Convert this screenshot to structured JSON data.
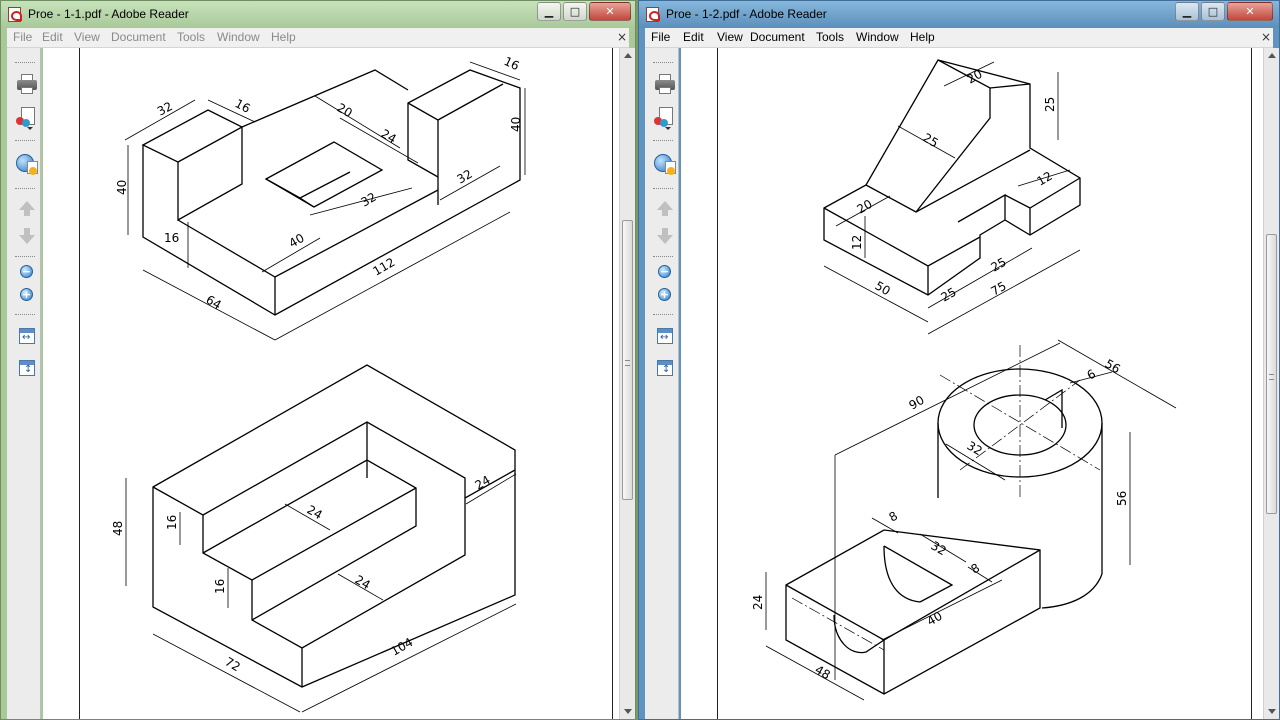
{
  "left_window": {
    "title": "Proe - 1-1.pdf - Adobe Reader",
    "menu": [
      "File",
      "Edit",
      "View",
      "Document",
      "Tools",
      "Window",
      "Help"
    ],
    "doc_close": "×",
    "buttons": {
      "minimize": "▁",
      "maximize": "□",
      "close": "✕"
    }
  },
  "right_window": {
    "title": "Proe - 1-2.pdf - Adobe Reader",
    "menu": [
      "File",
      "Edit",
      "View",
      "Document",
      "Tools",
      "Window",
      "Help"
    ],
    "doc_close": "×",
    "buttons": {
      "minimize": "▁",
      "maximize": "□",
      "close": "✕"
    }
  },
  "toolbar_icons": [
    "printer-icon",
    "document-colors-icon",
    "globe-document-icon",
    "previous-page-icon",
    "next-page-icon",
    "zoom-out-icon",
    "zoom-in-icon",
    "fit-width-icon",
    "fit-page-icon"
  ],
  "drawing1_dims": {
    "d1": "32",
    "d2": "16",
    "d3": "20",
    "d4": "24",
    "d5": "16",
    "d6": "40",
    "d7": "40",
    "d8": "32",
    "d9": "32",
    "d10": "16",
    "d11": "40",
    "d12": "112",
    "d13": "64"
  },
  "drawing2_dims": {
    "d1": "48",
    "d2": "16",
    "d3": "24",
    "d4": "24",
    "d5": "16",
    "d6": "24",
    "d7": "72",
    "d8": "104"
  },
  "drawing3_dims": {
    "d1": "20",
    "d2": "25",
    "d3": "25",
    "d4": "12",
    "d5": "20",
    "d6": "12",
    "d7": "50",
    "d8": "25",
    "d9": "25",
    "d10": "75"
  },
  "drawing4_dims": {
    "d1": "56",
    "d2": "90",
    "d3": "6",
    "d4": "32",
    "d5": "56",
    "d6": "8",
    "d7": "32",
    "d8": "8",
    "d9": "24",
    "d10": "40",
    "d11": "48"
  }
}
